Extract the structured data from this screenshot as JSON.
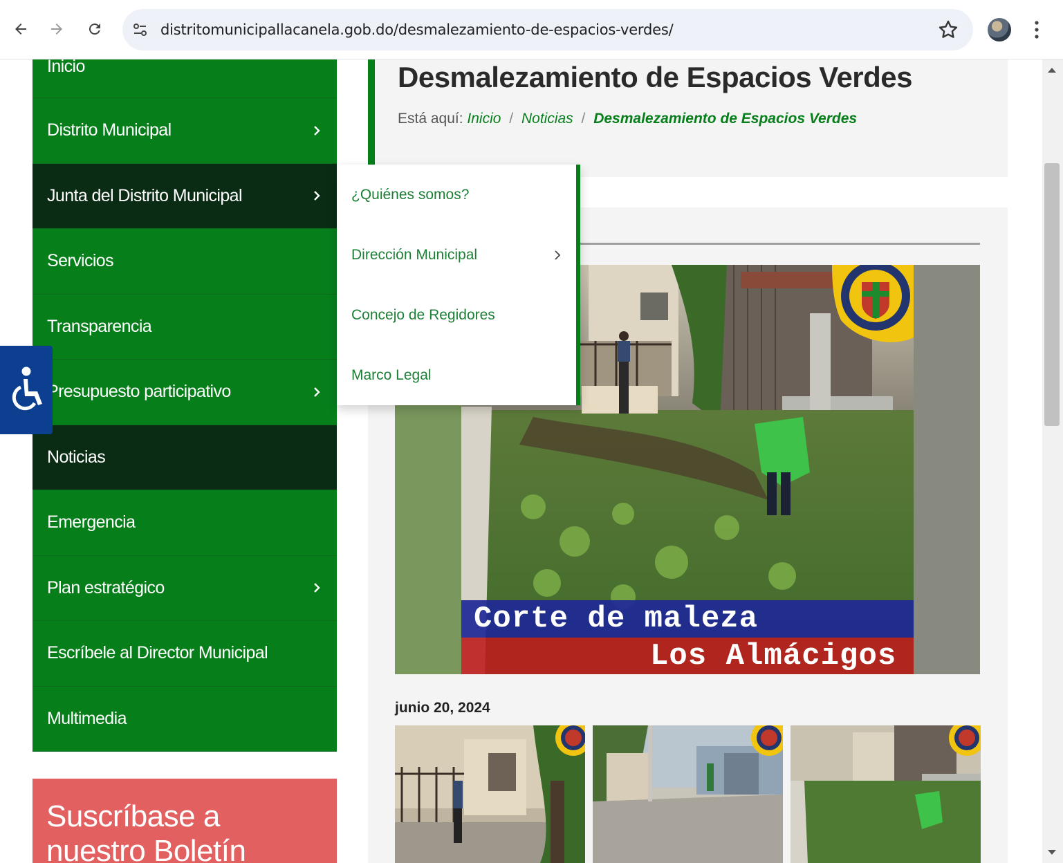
{
  "browser": {
    "url": "distritomunicipallacanela.gob.do/desmalezamiento-de-espacios-verdes/",
    "back_icon": "arrow-left-icon",
    "forward_icon": "arrow-right-icon",
    "reload_icon": "reload-icon",
    "site_info_icon": "tune-icon",
    "bookmark_icon": "star-icon",
    "menu_icon": "kebab-menu-icon"
  },
  "sidebar": {
    "items": [
      {
        "label": "Inicio",
        "has_submenu": false,
        "active": false
      },
      {
        "label": "Distrito Municipal",
        "has_submenu": true,
        "active": false
      },
      {
        "label": "Junta del Distrito Municipal",
        "has_submenu": true,
        "active": true
      },
      {
        "label": "Servicios",
        "has_submenu": false,
        "active": false
      },
      {
        "label": "Transparencia",
        "has_submenu": false,
        "active": false
      },
      {
        "label": "Presupuesto participativo",
        "has_submenu": true,
        "active": false
      },
      {
        "label": "Noticias",
        "has_submenu": false,
        "active": true
      },
      {
        "label": "Emergencia",
        "has_submenu": false,
        "active": false
      },
      {
        "label": "Plan estratégico",
        "has_submenu": true,
        "active": false
      },
      {
        "label": "Escríbele al Director Municipal",
        "has_submenu": false,
        "active": false
      },
      {
        "label": "Multimedia",
        "has_submenu": false,
        "active": false
      }
    ],
    "subscribe_title_line1": "Suscríbase a",
    "subscribe_title_line2": "nuestro Boletín"
  },
  "submenu": {
    "items": [
      {
        "label": "¿Quiénes somos?",
        "has_submenu": false
      },
      {
        "label": "Dirección Municipal",
        "has_submenu": true
      },
      {
        "label": "Concejo de Regidores",
        "has_submenu": false
      },
      {
        "label": "Marco Legal",
        "has_submenu": false
      }
    ]
  },
  "main": {
    "title": "Desmalezamiento de Espacios Verdes",
    "breadcrumb": {
      "prefix": "Está aquí:",
      "links": [
        "Inicio",
        "Noticias"
      ],
      "current": "Desmalezamiento de Espacios Verdes"
    },
    "hero_caption_line1": "Corte de maleza",
    "hero_caption_line2": "Los Almácigos",
    "post_date": "junio 20, 2024"
  },
  "accessibility": {
    "icon": "wheelchair-icon"
  },
  "colors": {
    "menu_green": "#067f1b",
    "menu_dark": "#0b2c14",
    "subscribe_red": "#e26060",
    "accessibility_blue": "#0d3f91",
    "link_green": "#1d7f35"
  }
}
